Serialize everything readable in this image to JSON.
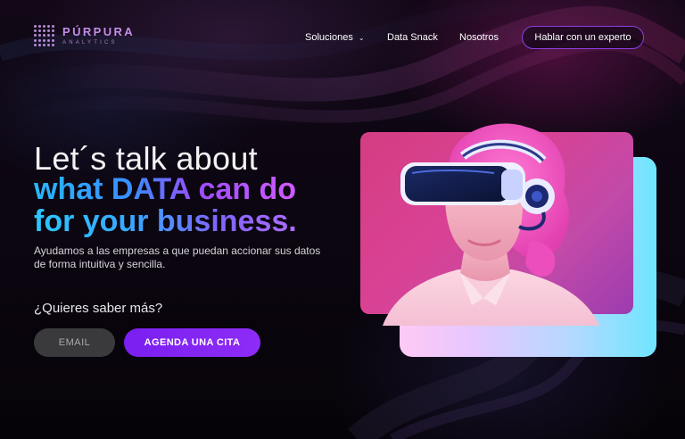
{
  "brand": {
    "name": "PÚRPURA",
    "tagline": "ANALYTICS",
    "accent": "#c28ee6"
  },
  "nav": {
    "items": [
      {
        "label": "Soluciones",
        "has_dropdown": true
      },
      {
        "label": "Data Snack"
      },
      {
        "label": "Nosotros"
      }
    ],
    "cta_label": "Hablar con un experto"
  },
  "hero": {
    "line1": "Let´s talk about",
    "line2": "what DATA can do",
    "line3": "for your business.",
    "subtitle": "Ayudamos a las empresas a que puedan accionar sus datos de forma intuitiva y sencilla.",
    "question": "¿Quieres saber más?"
  },
  "form": {
    "email_placeholder": "EMAIL",
    "submit_label": "AGENDA UNA CITA"
  },
  "colors": {
    "primary_button": "#7a1ff0",
    "outline_button": "#8d3fe0",
    "gradient_blue": "#27b8ff",
    "gradient_purple": "#d15bff"
  },
  "icons": {
    "logo": "dot-grid-icon",
    "dropdown": "chevron-down-icon"
  },
  "hero_image": {
    "subject": "woman with pink hair wearing a VR headset"
  }
}
